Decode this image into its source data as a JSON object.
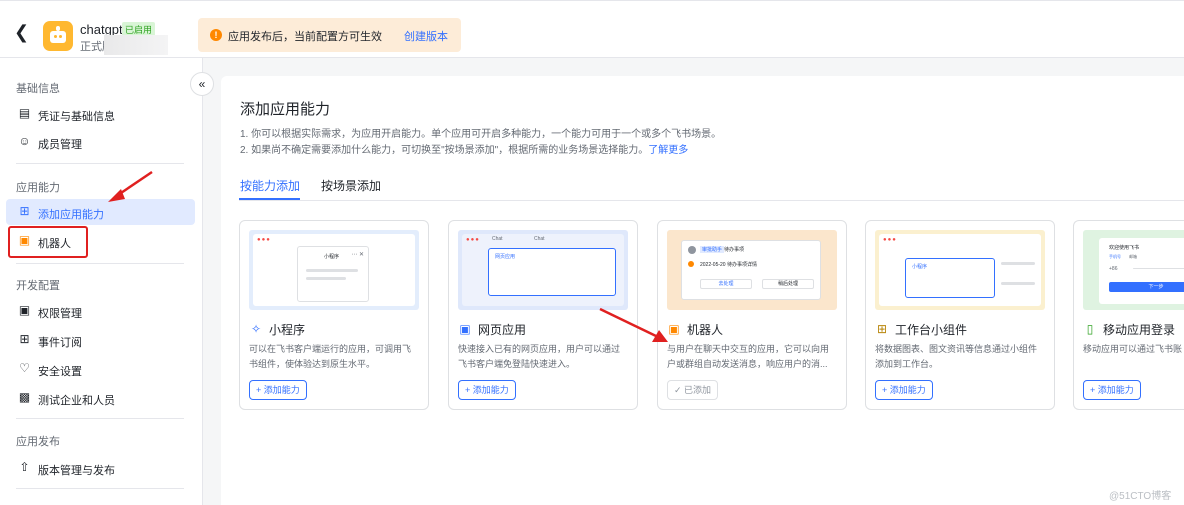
{
  "header": {
    "back_icon": "chevron-left-icon",
    "app_name": "chatgpt",
    "app_status": "已启用",
    "app_env": "正式版",
    "notice_text": "应用发布后，当前配置方可生效",
    "notice_link": "创建版本"
  },
  "sidebar": {
    "sections": [
      {
        "title": "基础信息",
        "items": [
          {
            "label": "凭证与基础信息",
            "icon": "credential-icon"
          },
          {
            "label": "成员管理",
            "icon": "user-icon"
          }
        ]
      },
      {
        "title": "应用能力",
        "items": [
          {
            "label": "添加应用能力",
            "icon": "add-capability-icon",
            "active": true
          },
          {
            "label": "机器人",
            "icon": "robot-icon"
          }
        ]
      },
      {
        "title": "开发配置",
        "items": [
          {
            "label": "权限管理",
            "icon": "lock-icon"
          },
          {
            "label": "事件订阅",
            "icon": "event-icon"
          },
          {
            "label": "安全设置",
            "icon": "shield-icon"
          },
          {
            "label": "测试企业和人员",
            "icon": "code-icon"
          }
        ]
      },
      {
        "title": "应用发布",
        "items": [
          {
            "label": "版本管理与发布",
            "icon": "upload-icon"
          }
        ]
      }
    ]
  },
  "main": {
    "title": "添加应用能力",
    "desc1": "1. 你可以根据实际需求，为应用开启能力。单个应用可开启多种能力，一个能力可用于一个或多个飞书场景。",
    "desc2": "2. 如果尚不确定需要添加什么能力，可切换至\"按场景添加\"，根据所需的业务场景选择能力。",
    "learn_more": "了解更多",
    "tabs": [
      "按能力添加",
      "按场景添加"
    ],
    "cards": [
      {
        "title": "小程序",
        "desc": "可以在飞书客户端运行的应用，可调用飞书组件，使体验达到原生水平。",
        "button": "+ 添加能力",
        "icon": "miniprogram-icon",
        "preview_title": "小程序"
      },
      {
        "title": "网页应用",
        "desc": "快速接入已有的网页应用，用户可以通过飞书客户端免登陆快速进入。",
        "button": "+ 添加能力",
        "icon": "webpage-icon",
        "preview_title": "网页应用",
        "preview_tabs": [
          "Chat",
          "Chat"
        ]
      },
      {
        "title": "机器人",
        "desc": "与用户在聊天中交互的应用，它可以向用户或群组自动发送消息，响应用户的消...",
        "button": "✓ 已添加",
        "icon": "robot-icon",
        "preview_name": "审批助手",
        "preview_badge": "待办事项",
        "preview_line": "2022-05-20 待办事项详情",
        "preview_btn1": "去处理",
        "preview_btn2": "稍后处理"
      },
      {
        "title": "工作台小组件",
        "desc": "将数据图表、图文资讯等信息通过小组件添加到工作台。",
        "button": "+ 添加能力",
        "icon": "widget-icon",
        "preview_title": "小程序"
      },
      {
        "title": "移动应用登录",
        "desc": "移动应用可以通过飞书账",
        "button": "+ 添加能力",
        "icon": "mobile-icon",
        "preview_title": "欢迎使用飞书",
        "preview_tabs": [
          "手机号",
          "邮箱"
        ],
        "preview_code": "+86",
        "preview_btn": "下一步"
      }
    ]
  },
  "watermark": "@51CTO博客",
  "colors": {
    "accent": "#3370ff",
    "arrow": "#e02020",
    "notice_bg": "#fdecd8"
  }
}
